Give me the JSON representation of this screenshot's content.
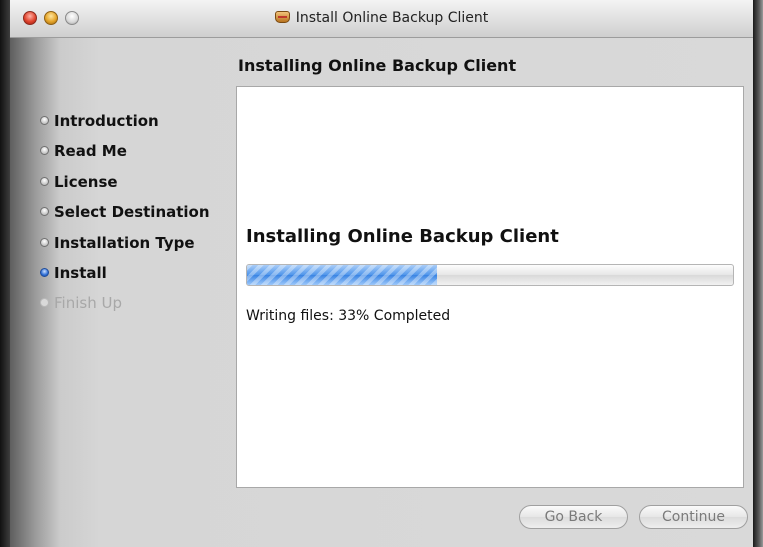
{
  "window": {
    "title": "Install Online Backup Client",
    "title_icon": "package-icon"
  },
  "header": {
    "heading": "Installing Online Backup Client"
  },
  "sidebar": {
    "steps": [
      {
        "label": "Introduction",
        "state": "done"
      },
      {
        "label": "Read Me",
        "state": "done"
      },
      {
        "label": "License",
        "state": "done"
      },
      {
        "label": "Select Destination",
        "state": "done"
      },
      {
        "label": "Installation Type",
        "state": "done"
      },
      {
        "label": "Install",
        "state": "active"
      },
      {
        "label": "Finish Up",
        "state": "future"
      }
    ]
  },
  "main": {
    "status_title": "Installing Online Backup Client",
    "progress_fraction": 0.39,
    "status_text": "Writing files: 33% Completed"
  },
  "buttons": {
    "back": "Go Back",
    "continue": "Continue"
  },
  "colors": {
    "active_step": "#2f6fd6",
    "progress_fill": "#4f95ea",
    "disabled_text": "#7a7a7a"
  }
}
